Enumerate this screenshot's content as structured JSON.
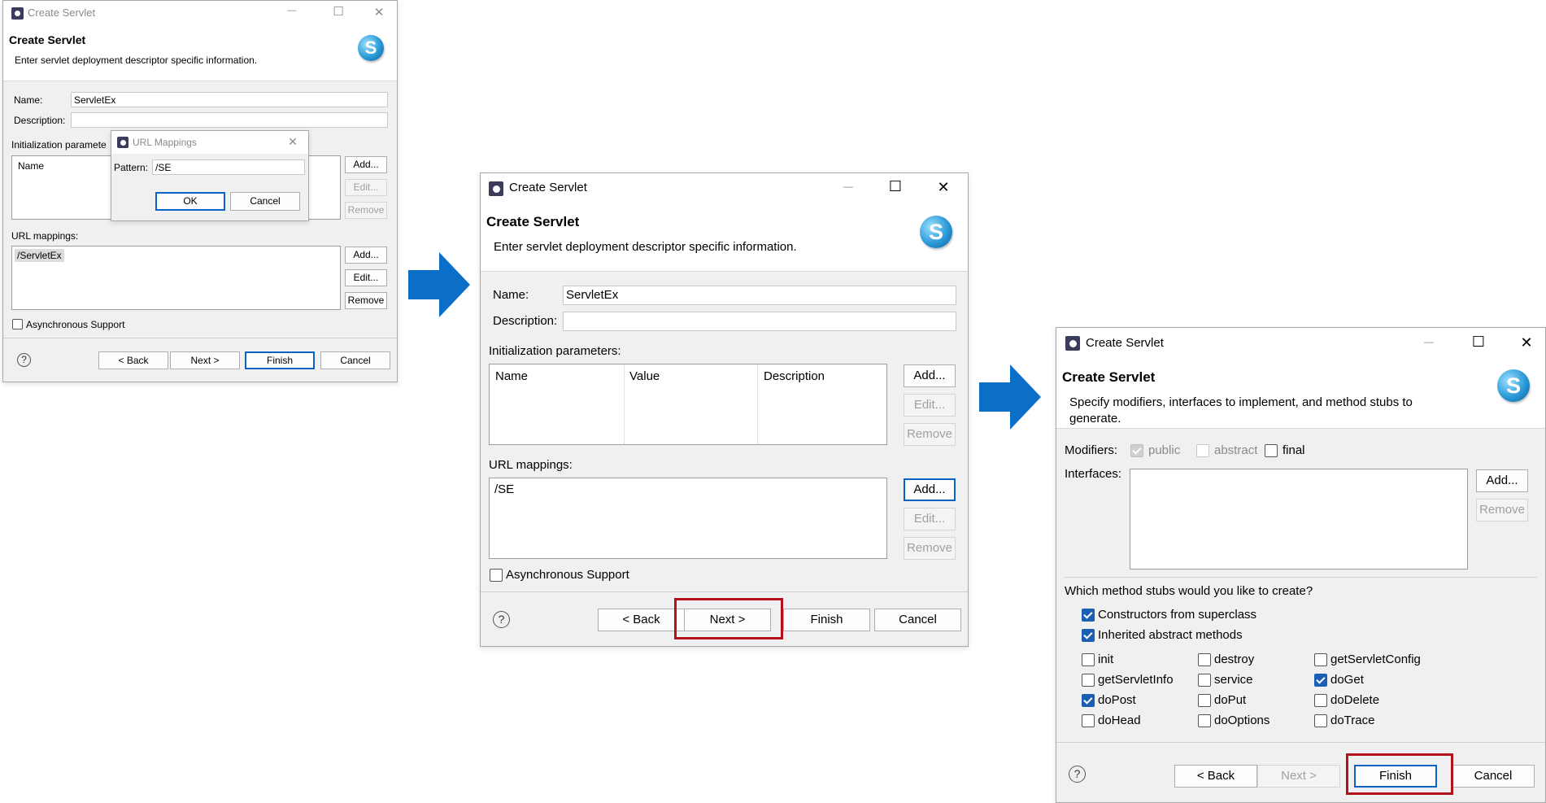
{
  "dialog_title": "Create Servlet",
  "header_title": "Create Servlet",
  "logo_letter": "S",
  "win_minimize": "—",
  "win_maximize": "☐",
  "win_close": "✕",
  "help_glyph": "?",
  "colors": {
    "arrow": "#0b6fc7",
    "highlight": "#b2121b",
    "checkbox": "#1a5fb4"
  },
  "page1": {
    "description": "Enter servlet deployment descriptor specific information.",
    "name_label": "Name:",
    "name_value": "ServletEx",
    "description_label": "Description:",
    "description_value": "",
    "init_params_label": "Initialization paramete",
    "init_params_column": "Name",
    "url_mappings_label": "URL mappings:",
    "url_mapping_item": "/ServletEx",
    "async_label": "Asynchronous Support",
    "add_button": "Add...",
    "edit_button": "Edit...",
    "remove_button": "Remove",
    "back_button": "< Back",
    "next_button": "Next >",
    "finish_button": "Finish",
    "cancel_button": "Cancel",
    "popup": {
      "title": "URL Mappings",
      "pattern_label": "Pattern:",
      "pattern_value": "/SE",
      "ok_button": "OK",
      "cancel_button": "Cancel"
    }
  },
  "page2": {
    "description": "Enter servlet deployment descriptor specific information.",
    "name_label": "Name:",
    "name_value": "ServletEx",
    "description_label": "Description:",
    "description_value": "",
    "init_params_label": "Initialization parameters:",
    "init_params_columns": [
      "Name",
      "Value",
      "Description"
    ],
    "url_mappings_label": "URL mappings:",
    "url_mapping_item": "/SE",
    "async_label": "Asynchronous Support",
    "add_button": "Add...",
    "edit_button": "Edit...",
    "remove_button": "Remove",
    "back_button": "< Back",
    "next_button": "Next >",
    "finish_button": "Finish",
    "cancel_button": "Cancel"
  },
  "page3": {
    "description": "Specify modifiers, interfaces to implement, and method stubs to generate.",
    "modifiers_label": "Modifiers:",
    "modifier_public": "public",
    "modifier_abstract": "abstract",
    "modifier_final": "final",
    "interfaces_label": "Interfaces:",
    "add_button": "Add...",
    "remove_button": "Remove",
    "stubs_question": "Which method stubs would you like to create?",
    "constructors_label": "Constructors from superclass",
    "inherited_label": "Inherited abstract methods",
    "methods": {
      "init": "init",
      "destroy": "destroy",
      "getServletConfig": "getServletConfig",
      "getServletInfo": "getServletInfo",
      "service": "service",
      "doGet": "doGet",
      "doPost": "doPost",
      "doPut": "doPut",
      "doDelete": "doDelete",
      "doHead": "doHead",
      "doOptions": "doOptions",
      "doTrace": "doTrace"
    },
    "back_button": "< Back",
    "next_button": "Next >",
    "finish_button": "Finish",
    "cancel_button": "Cancel"
  }
}
